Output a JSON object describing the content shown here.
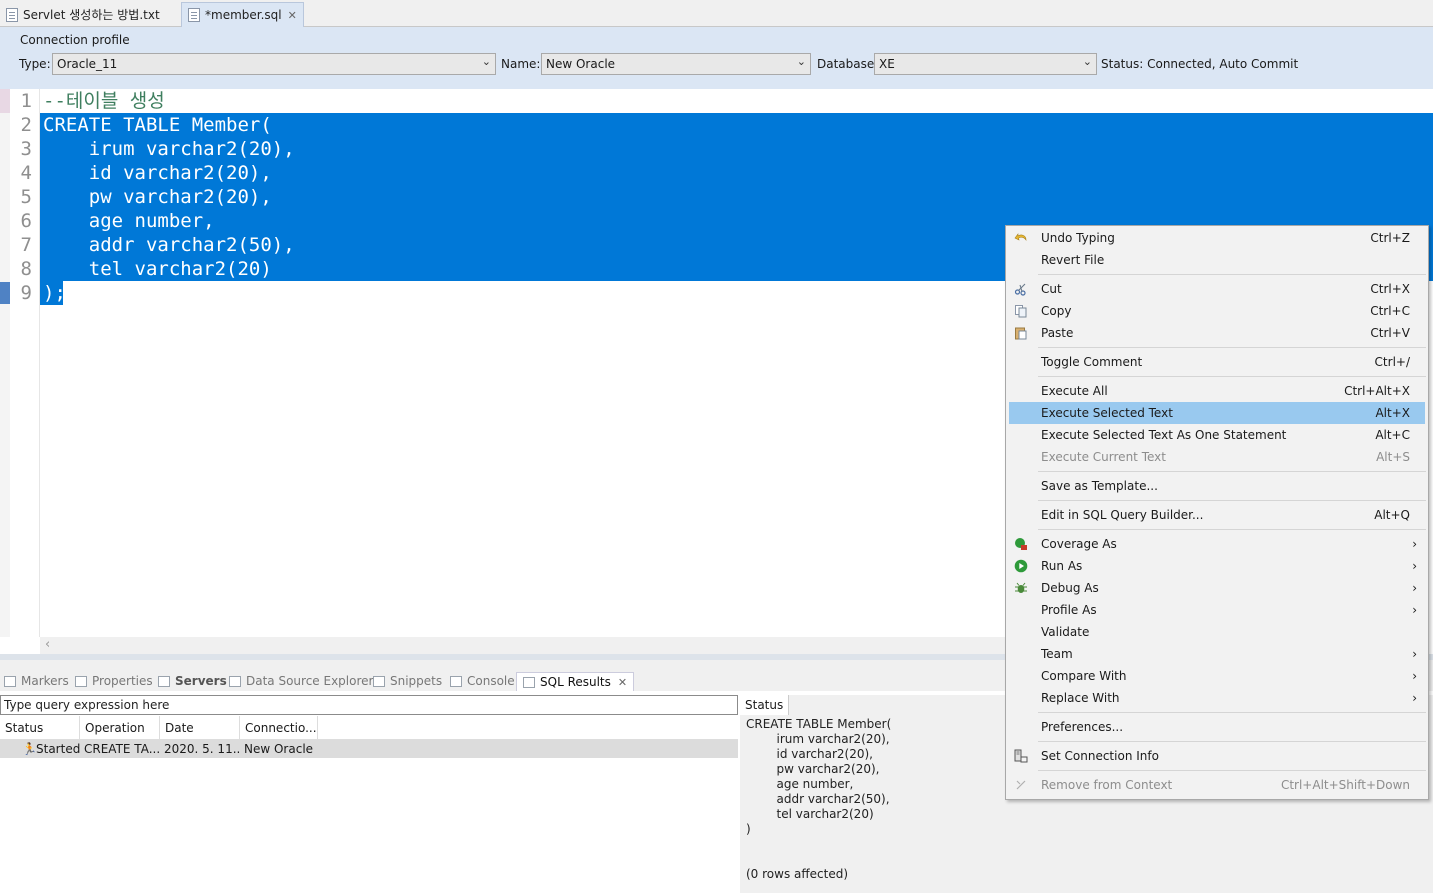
{
  "editor_tabs": [
    {
      "label": "Servlet 생성하는 방법.txt"
    },
    {
      "label": "*member.sql"
    }
  ],
  "connection": {
    "title": "Connection profile",
    "type_label": "Type:",
    "type_value": "Oracle_11",
    "name_label": "Name:",
    "name_value": "New Oracle",
    "database_label": "Database:",
    "database_value": "XE",
    "status_label": "Status:",
    "status_value": "Connected, Auto Commit"
  },
  "code": {
    "line_numbers": [
      "1",
      "2",
      "3",
      "4",
      "5",
      "6",
      "7",
      "8",
      "9"
    ],
    "lines": [
      "--테이블 생성",
      "CREATE TABLE Member(",
      "    irum varchar2(20),",
      "    id varchar2(20),",
      "    pw varchar2(20),",
      "    age number,",
      "    addr varchar2(50),",
      "    tel varchar2(20)",
      ");"
    ],
    "selection_color": "#0078d7",
    "comment_color": "#3f7f5f"
  },
  "views": {
    "tabs": [
      "Markers",
      "Properties",
      "Servers",
      "Data Source Explorer",
      "Snippets",
      "Console",
      "SQL Results"
    ],
    "query_placeholder": "Type query expression here",
    "columns": [
      "Status",
      "Operation",
      "Date",
      "Connectio..."
    ],
    "row": {
      "status": "Started",
      "operation": "CREATE TA...",
      "date": "2020. 5. 11...",
      "connection": "New Oracle"
    },
    "status_header": "Status",
    "status_lines": "CREATE TABLE Member(\n        irum varchar2(20),\n        id varchar2(20),\n        pw varchar2(20),\n        age number,\n        addr varchar2(50),\n        tel varchar2(20)\n)",
    "status_footer": "(0 rows affected)"
  },
  "menu": {
    "items": [
      {
        "label": "Undo Typing",
        "shortcut": "Ctrl+Z",
        "icon": "undo-icon"
      },
      {
        "label": "Revert File",
        "shortcut": ""
      },
      {
        "label": "Cut",
        "shortcut": "Ctrl+X",
        "icon": "scissors-icon"
      },
      {
        "label": "Copy",
        "shortcut": "Ctrl+C",
        "icon": "copy-icon"
      },
      {
        "label": "Paste",
        "shortcut": "Ctrl+V",
        "icon": "paste-icon"
      },
      {
        "label": "Toggle Comment",
        "shortcut": "Ctrl+/"
      },
      {
        "label": "Execute All",
        "shortcut": "Ctrl+Alt+X"
      },
      {
        "label": "Execute Selected Text",
        "shortcut": "Alt+X"
      },
      {
        "label": "Execute Selected Text As One Statement",
        "shortcut": "Alt+C"
      },
      {
        "label": "Execute Current Text",
        "shortcut": "Alt+S"
      },
      {
        "label": "Save as Template...",
        "shortcut": ""
      },
      {
        "label": "Edit in SQL Query Builder...",
        "shortcut": "Alt+Q"
      },
      {
        "label": "Coverage As",
        "submenu": "›",
        "icon": "coverage-icon"
      },
      {
        "label": "Run As",
        "submenu": "›",
        "icon": "run-icon"
      },
      {
        "label": "Debug As",
        "submenu": "›",
        "icon": "debug-icon"
      },
      {
        "label": "Profile As",
        "submenu": "›"
      },
      {
        "label": "Validate"
      },
      {
        "label": "Team",
        "submenu": "›"
      },
      {
        "label": "Compare With",
        "submenu": "›"
      },
      {
        "label": "Replace With",
        "submenu": "›"
      },
      {
        "label": "Preferences..."
      },
      {
        "label": "Set Connection Info",
        "icon": "connection-icon"
      },
      {
        "label": "Remove from Context",
        "shortcut": "Ctrl+Alt+Shift+Down"
      }
    ],
    "highlight_color": "#99c9ef"
  }
}
